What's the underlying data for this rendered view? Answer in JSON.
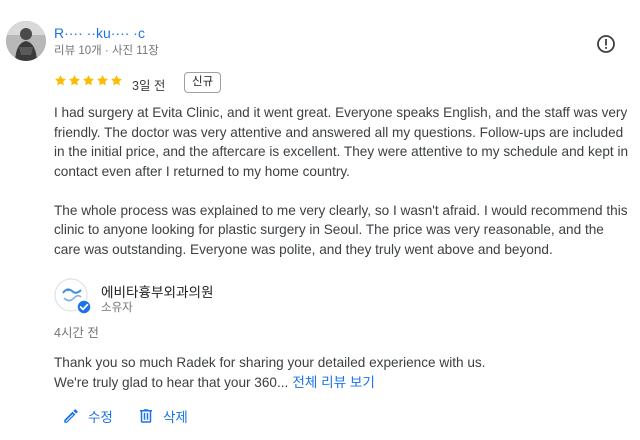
{
  "reviewer": {
    "name": "R···· ··ku···· ·c",
    "meta": "리뷰 10개 · 사진 11장"
  },
  "review": {
    "rating": 5,
    "date": "3일 전",
    "badge": "신규",
    "paragraphs": [
      "I had surgery at Evita Clinic, and it went great. Everyone speaks English, and the staff was very friendly. The doctor was very attentive and answered all my questions. Follow-ups are included in the initial price, and the aftercare is excellent. They were attentive to my schedule and kept in contact even after I returned to my home country.",
      "The whole process was explained to me very clearly, so I wasn't afraid. I would recommend this clinic to anyone looking for plastic surgery in Seoul. The price was very reasonable, and the care was outstanding. Everyone was polite, and they truly went above and beyond."
    ]
  },
  "owner": {
    "name": "에비타흉부외과의원",
    "role": "소유자",
    "reply_time": "4시간 전",
    "reply_line1": "Thank you so much Radek for sharing your detailed experience with us.",
    "reply_line2": "We're truly glad to hear that your 360...",
    "read_more": "전체 리뷰 보기"
  },
  "actions": {
    "edit_label": "수정",
    "delete_label": "삭제"
  },
  "colors": {
    "accent": "#1a73e8",
    "star": "#fbbc04",
    "verified": "#1a73e8"
  },
  "icons": [
    "avatar",
    "report-icon",
    "star-icon",
    "verified-badge-icon",
    "pencil-icon",
    "trash-icon"
  ]
}
